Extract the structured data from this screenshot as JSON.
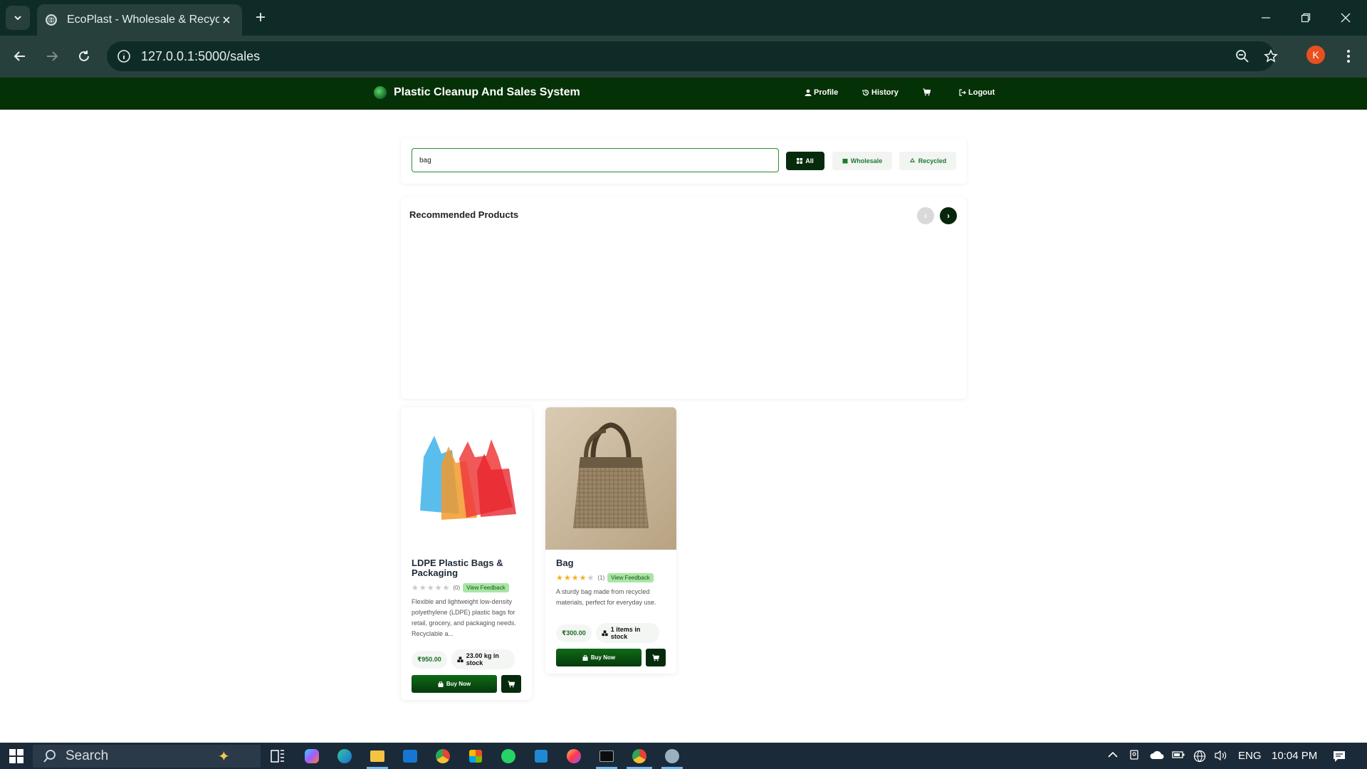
{
  "browser": {
    "tab_title": "EcoPlast - Wholesale & Recycled",
    "url": "127.0.0.1:5000/sales",
    "profile_initial": "K"
  },
  "app": {
    "brand": "Plastic Cleanup And Sales System",
    "nav": {
      "profile": "Profile",
      "history": "History",
      "logout": "Logout"
    }
  },
  "search": {
    "value": "bag",
    "filters": {
      "all": "All",
      "wholesale": "Wholesale",
      "recycled": "Recycled"
    },
    "active_filter": "All"
  },
  "recommended": {
    "title": "Recommended Products",
    "prev_label": "‹",
    "next_label": "›"
  },
  "products": [
    {
      "name": "LDPE Plastic Bags & Packaging",
      "rating": 0,
      "rating_count": "(0)",
      "feedback_label": "View Feedback",
      "description": "Flexible and lightweight low-density polyethylene (LDPE) plastic bags for retail, grocery, and packaging needs. Recyclable a...",
      "price": "₹950.00",
      "stock": "23.00 kg in stock",
      "buy_label": "Buy Now"
    },
    {
      "name": "Bag",
      "rating": 4,
      "rating_count": "(1)",
      "feedback_label": "View Feedback",
      "description": "A sturdy bag made from recycled materials, perfect for everyday use.",
      "price": "₹300.00",
      "stock": "1 items in stock",
      "buy_label": "Buy Now"
    }
  ],
  "taskbar": {
    "search_placeholder": "Search",
    "language": "ENG",
    "time": "10:04 PM"
  },
  "colors": {
    "chrome_dark": "#0f2b28",
    "app_nav": "#053106",
    "accent_green": "#1f7a2d",
    "star": "#f2b01e"
  }
}
